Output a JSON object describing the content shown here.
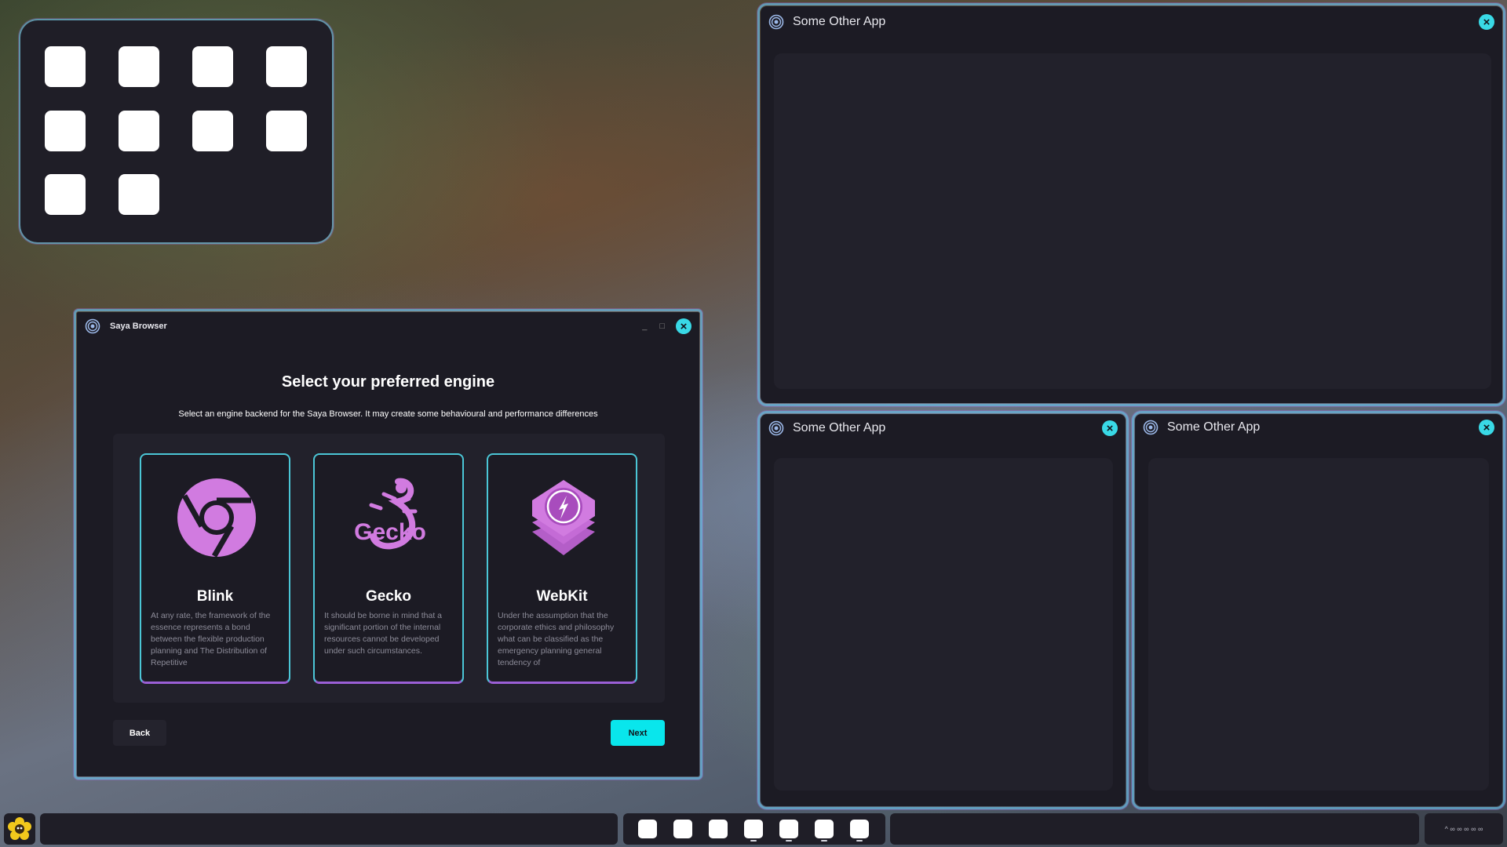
{
  "launcher": {
    "tile_count": 10
  },
  "saya_window": {
    "title": "Saya Browser",
    "minimize_label": "_",
    "maximize_label": "□",
    "close_label": "×",
    "heading": "Select your preferred engine",
    "subheading": "Select an engine backend for the Saya Browser. It may create some behavioural and performance differences",
    "engines": [
      {
        "name": "Blink",
        "icon": "chrome-logo-icon",
        "description": "At any rate, the framework of the essence represents a bond between the flexible production planning and The Distribution of Repetitive"
      },
      {
        "name": "Gecko",
        "icon": "gecko-logo-icon",
        "description": "It should be borne in mind that a significant portion of the internal resources cannot be developed under such circumstances."
      },
      {
        "name": "WebKit",
        "icon": "webkit-logo-icon",
        "description": "Under the assumption that the corporate ethics and philosophy what can be classified as the emergency planning general tendency of"
      }
    ],
    "back_label": "Back",
    "next_label": "Next"
  },
  "other_windows": [
    {
      "title": "Some Other App",
      "close_label": "×"
    },
    {
      "title": "Some Other App",
      "close_label": "×"
    },
    {
      "title": "Some Other App",
      "close_label": "×"
    }
  ],
  "taskbar": {
    "tray_text": "^ ∞ ∞ ∞ ∞ ∞",
    "app_tile_count": 7
  },
  "colors": {
    "accent_cyan": "#09e6ec",
    "logo_purple": "#d17be0",
    "window_bg": "#1c1b24"
  }
}
